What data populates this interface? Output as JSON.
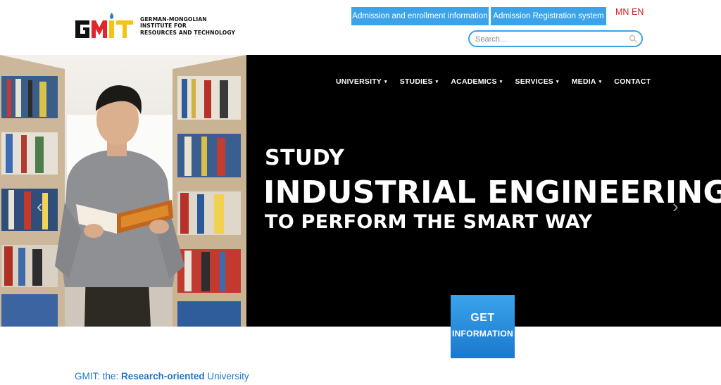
{
  "header": {
    "logo": {
      "mark_text": "GMIT",
      "lines": [
        "GERMAN-MONGOLIAN",
        "INSTITUTE FOR",
        "RESOURCES AND TECHNOLOGY"
      ]
    },
    "buttons": {
      "admission": "Admission and enrollment information",
      "registration": "Admission Registration system"
    },
    "languages": [
      "MN",
      "EN"
    ],
    "search": {
      "placeholder": "Search...",
      "value": ""
    }
  },
  "nav": {
    "items": [
      {
        "label": "UNIVERSITY",
        "has_dropdown": true
      },
      {
        "label": "STUDIES",
        "has_dropdown": true
      },
      {
        "label": "ACADEMICS",
        "has_dropdown": true
      },
      {
        "label": "SERVICES",
        "has_dropdown": true
      },
      {
        "label": "MEDIA",
        "has_dropdown": true
      },
      {
        "label": "CONTACT",
        "has_dropdown": false
      }
    ],
    "caret": "▾"
  },
  "hero": {
    "line1": "STUDY",
    "line2": "INDUSTRIAL ENGINEERING",
    "line3": "TO PERFORM THE SMART WAY",
    "prev_glyph": "‹",
    "next_glyph": "›"
  },
  "cta": {
    "line1": "GET",
    "line2": "INFORMATION"
  },
  "tagline": {
    "prefix": "GMIT: the: ",
    "highlight": "Research-oriented",
    "suffix": " University"
  },
  "colors": {
    "accent": "#3aa3ea",
    "lang": "#d01f1f",
    "logo_red": "#e0262b",
    "logo_yellow": "#f4c414",
    "hero_bg": "#000000"
  }
}
